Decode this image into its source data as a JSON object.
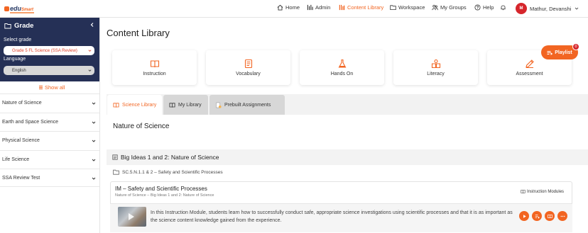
{
  "brand": {
    "logo_main": "edu",
    "logo_accent": "Smart"
  },
  "nav": [
    {
      "label": "Home",
      "icon": "home-icon"
    },
    {
      "label": "Admin",
      "icon": "admin-icon"
    },
    {
      "label": "Content Library",
      "icon": "content-library-icon",
      "active": true
    },
    {
      "label": "Workspace",
      "icon": "folder-icon"
    },
    {
      "label": "My Groups",
      "icon": "groups-icon"
    },
    {
      "label": "Help",
      "icon": "help-icon"
    }
  ],
  "user": {
    "initial": "M",
    "name": "Mathur, Devanshi"
  },
  "sidebar": {
    "title": "Grade",
    "select_grade_label": "Select grade",
    "grade_value": "Grade 5 FL Science (SSA Review)",
    "language_label": "Language",
    "language_value": "English",
    "show_all": "Show all",
    "categories": [
      "Nature of Science",
      "Earth and Space Science",
      "Physical Science",
      "Life Science",
      "SSA Review Test"
    ]
  },
  "main": {
    "title": "Content Library",
    "cards": [
      "Instruction",
      "Vocabulary",
      "Hands On",
      "Literacy",
      "Assessment"
    ],
    "playlist": {
      "label": "Playlist",
      "count": "0"
    },
    "tabs": [
      "Science Library",
      "My Library",
      "Prebuilt Assignments"
    ],
    "section_title": "Nature of Science",
    "group_title": "Big Ideas 1 and 2: Nature of Science",
    "folder": "SC.5.N.1.1 & 2 – Safety and Scientific Processes",
    "module": {
      "title": "IM – Safety and Scientific Processes",
      "breadcrumb": "Nature of Science – Big Ideas 1 and 2: Nature of Science",
      "type": "Instruction Modules",
      "description": "In this Instruction Module, students learn how to successfully conduct safe, appropriate science investigations using scientific processes and that it is as important as the science content knowledge gained from the experience."
    }
  },
  "colors": {
    "accent": "#f26522",
    "sidebar": "#253056",
    "avatar": "#d6262c"
  }
}
